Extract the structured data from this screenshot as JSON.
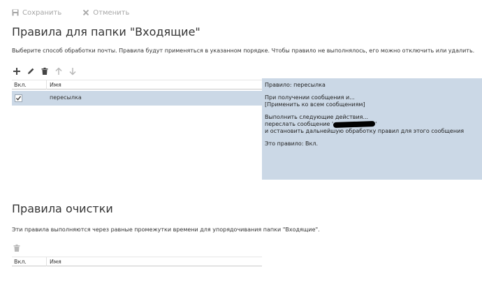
{
  "commands": {
    "save_label": "Сохранить",
    "cancel_label": "Отменить"
  },
  "inbox_rules": {
    "title": "Правила для папки \"Входящие\"",
    "description": "Выберите способ обработки почты. Правила будут применяться в указанном порядке. Чтобы правило не выполнялось, его можно отключить или удалить.",
    "toolbar_icons": [
      "add-icon",
      "edit-icon",
      "delete-icon",
      "arrow-up-icon",
      "arrow-down-icon"
    ],
    "columns": [
      "Вкл.",
      "Имя"
    ],
    "rows": [
      {
        "enabled": true,
        "name": "пересылка"
      }
    ],
    "details": {
      "title": "Правило: пересылка",
      "condition_line1": "При получении сообщения и...",
      "condition_line2": "[Применить ко всем сообщениям]",
      "actions_line1": "Выполнить следующие действия...",
      "actions_line2_prefix": "переслать сообщение '",
      "actions_line2_suffix": "'",
      "actions_line3": "и остановить дальнейшую обработку правил для этого сообщения",
      "status": "Это правило: Вкл."
    }
  },
  "sweep_rules": {
    "title": "Правила очистки",
    "description": "Эти правила выполняются через равные промежутки времени для упорядочивания папки \"Входящие\".",
    "toolbar_icons": [
      "delete-icon"
    ],
    "columns": [
      "Вкл.",
      "Имя"
    ]
  },
  "colors": {
    "selection": "#cbd8e6",
    "icon_active": "#444444",
    "icon_disabled": "#b8b8b8",
    "command_text": "#a6a6a6"
  }
}
